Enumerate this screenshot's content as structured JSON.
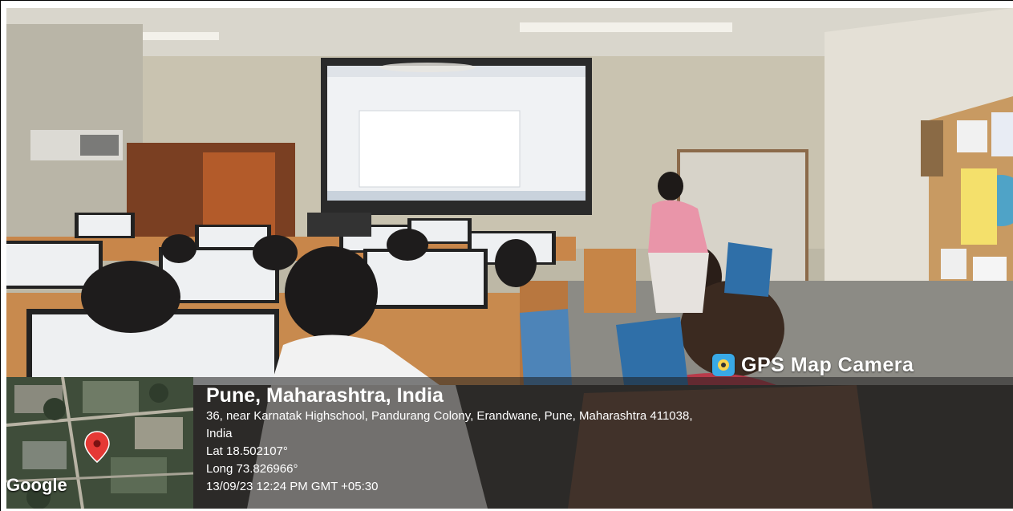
{
  "stamp": {
    "brand": "GPS Map Camera",
    "brand_icon": "gps-map-camera-logo-icon",
    "map_credit": "Google",
    "place": "Pune, Maharashtra, India",
    "address_line1": "36, near Karnatak Highschool, Pandurang Colony, Erandwane, Pune, Maharashtra 411038,",
    "address_line2": "India",
    "latitude": "Lat 18.502107°",
    "longitude": "Long 73.826966°",
    "datetime": "13/09/23 12:24 PM GMT +05:30",
    "pin_icon": "map-pin-icon",
    "pin_color": "#e53935"
  },
  "colors": {
    "overlay": "#1e1e1e",
    "accent": "#39a9e6",
    "text": "#ffffff"
  }
}
